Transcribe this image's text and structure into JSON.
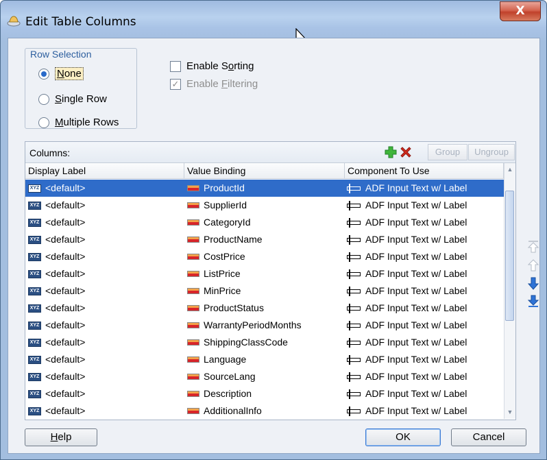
{
  "window": {
    "title": "Edit Table Columns",
    "close_label": "X"
  },
  "row_selection": {
    "legend": "Row Selection",
    "options": [
      {
        "pre": "",
        "mn": "N",
        "post": "one",
        "selected": true
      },
      {
        "pre": "",
        "mn": "S",
        "post": "ingle Row",
        "selected": false
      },
      {
        "pre": "",
        "mn": "M",
        "post": "ultiple Rows",
        "selected": false
      }
    ]
  },
  "enable_sorting": {
    "pre": "Enable S",
    "mn": "o",
    "post": "rting",
    "checked": false
  },
  "enable_filtering": {
    "pre": "Enable ",
    "mn": "F",
    "post": "iltering",
    "checked": true,
    "disabled": true
  },
  "columns_panel": {
    "label": "Columns:",
    "group_label": "Group",
    "ungroup_label": "Ungroup",
    "headers": [
      "Display Label",
      "Value Binding",
      "Component To Use"
    ],
    "rows": [
      {
        "display": "<default>",
        "binding": "ProductId",
        "component": "ADF Input Text w/ Label"
      },
      {
        "display": "<default>",
        "binding": "SupplierId",
        "component": "ADF Input Text w/ Label"
      },
      {
        "display": "<default>",
        "binding": "CategoryId",
        "component": "ADF Input Text w/ Label"
      },
      {
        "display": "<default>",
        "binding": "ProductName",
        "component": "ADF Input Text w/ Label"
      },
      {
        "display": "<default>",
        "binding": "CostPrice",
        "component": "ADF Input Text w/ Label"
      },
      {
        "display": "<default>",
        "binding": "ListPrice",
        "component": "ADF Input Text w/ Label"
      },
      {
        "display": "<default>",
        "binding": "MinPrice",
        "component": "ADF Input Text w/ Label"
      },
      {
        "display": "<default>",
        "binding": "ProductStatus",
        "component": "ADF Input Text w/ Label"
      },
      {
        "display": "<default>",
        "binding": "WarrantyPeriodMonths",
        "component": "ADF Input Text w/ Label"
      },
      {
        "display": "<default>",
        "binding": "ShippingClassCode",
        "component": "ADF Input Text w/ Label"
      },
      {
        "display": "<default>",
        "binding": "Language",
        "component": "ADF Input Text w/ Label"
      },
      {
        "display": "<default>",
        "binding": "SourceLang",
        "component": "ADF Input Text w/ Label"
      },
      {
        "display": "<default>",
        "binding": "Description",
        "component": "ADF Input Text w/ Label"
      },
      {
        "display": "<default>",
        "binding": "AdditionalInfo",
        "component": "ADF Input Text w/ Label"
      }
    ],
    "selected_row": 0,
    "icon_text": "XYZ"
  },
  "footer": {
    "help": {
      "pre": "",
      "mn": "H",
      "post": "elp"
    },
    "ok_label": "OK",
    "cancel_label": "Cancel"
  },
  "colors": {
    "selection": "#2f6cc9",
    "legend": "#2c5e9e",
    "move_arrow": "#2f73d6"
  }
}
